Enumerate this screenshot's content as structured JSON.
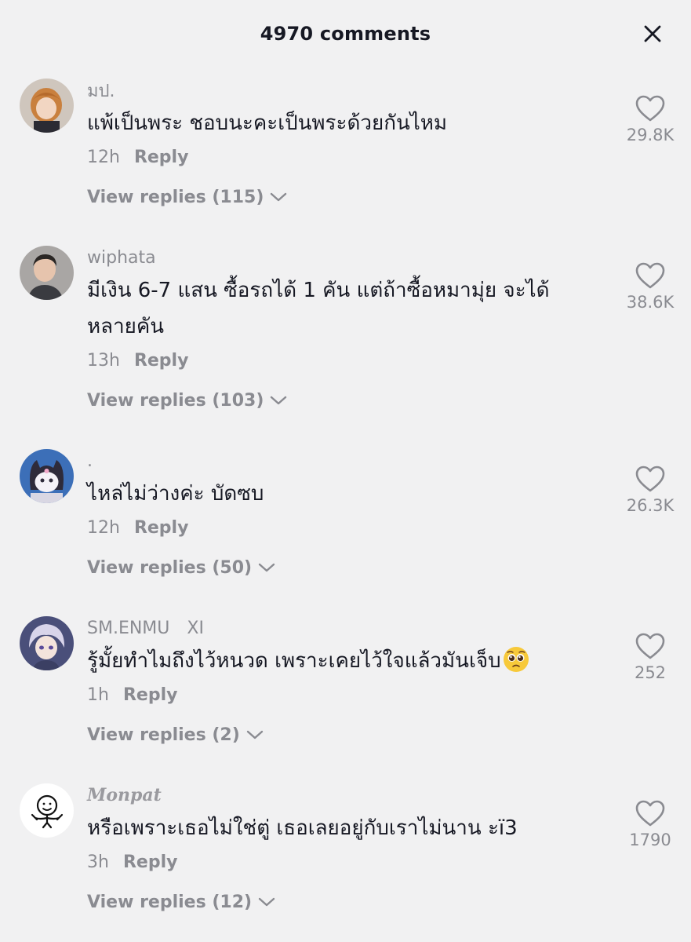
{
  "header": {
    "title": "4970 comments",
    "close_icon": "close-icon"
  },
  "comments": [
    {
      "username": "มป.",
      "text": "แพ้เป็นพระ ชอบนะคะเป็นพระด้วยกันไหม",
      "time": "12h",
      "reply": "Reply",
      "view_replies": "View replies (115)",
      "likes": "29.8K"
    },
    {
      "username": "wiphata",
      "text_line1": "มีเงิน 6-7 แสน ซื้อรถได้ 1 คัน แต่ถ้าซื้อหมามุ่ย จะได้",
      "text_line2": "หลายคัน",
      "time": "13h",
      "reply": "Reply",
      "view_replies": "View replies (103)",
      "likes": "38.6K"
    },
    {
      "username": ".",
      "text": "ไหล่ไม่ว่างค่ะ บัดซบ",
      "time": "12h",
      "reply": "Reply",
      "view_replies": "View replies (50)",
      "likes": "26.3K"
    },
    {
      "username": "SM.ENMU",
      "tag": "XI",
      "text": "รู้มั้ยทำไมถึงไว้หนวด  เพราะเคยไว้ใจแล้วมันเจ็บ",
      "emoji": "pleading-face-emoji",
      "time": "1h",
      "reply": "Reply",
      "view_replies": "View replies (2)",
      "likes": "252"
    },
    {
      "username": "Monpat",
      "text": "หรือเพราะเธอไม่ใช่ตู่ เธอเลยอยู่กับเราไม่นาน ะï3",
      "time": "3h",
      "reply": "Reply",
      "view_replies": "View replies (12)",
      "likes": "1790"
    }
  ],
  "colors": {
    "background": "#f1f1f2",
    "primary_text": "#161823",
    "secondary_text": "#8a8b91"
  }
}
